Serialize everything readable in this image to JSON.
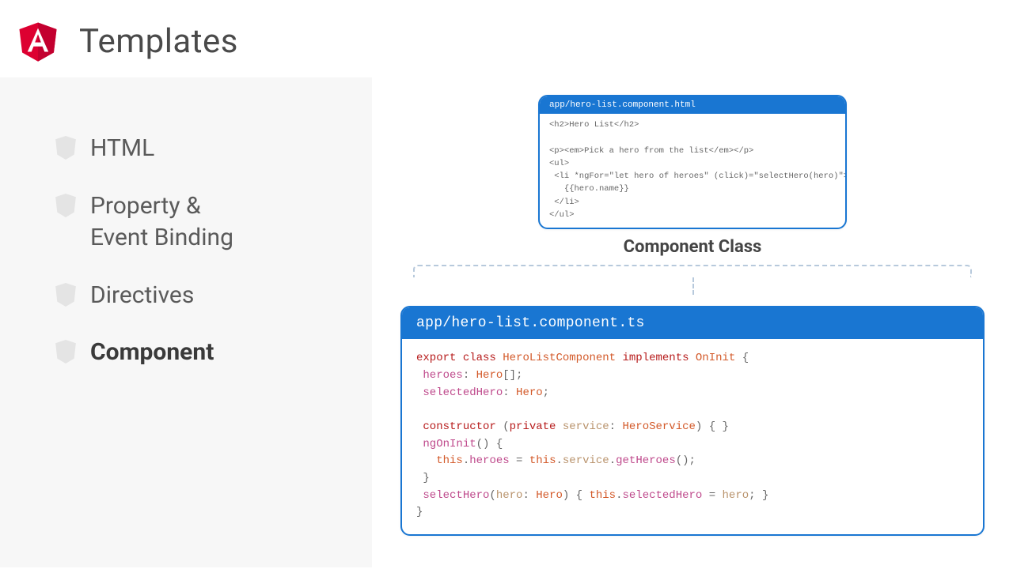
{
  "header": {
    "title": "Templates"
  },
  "colors": {
    "accent": "#1976d2",
    "logo": "#dd0031"
  },
  "nav": [
    {
      "label": "HTML",
      "active": false
    },
    {
      "label": "Property &\nEvent Binding",
      "active": false
    },
    {
      "label": "Directives",
      "active": false
    },
    {
      "label": "Component",
      "active": true
    }
  ],
  "section_label": "Component Class",
  "template_card": {
    "path": "app/hero-list.component.html",
    "lines": [
      "<h2>Hero List</h2>",
      "",
      "<p><em>Pick a hero from the list</em></p>",
      "<ul>",
      " <li *ngFor=\"let hero of heroes\" (click)=\"selectHero(hero)\">",
      "   {{hero.name}}",
      " </li>",
      "</ul>"
    ]
  },
  "component_card": {
    "path": "app/hero-list.component.ts",
    "lines": [
      "export class HeroListComponent implements OnInit {",
      " heroes: Hero[];",
      " selectedHero: Hero;",
      "",
      " constructor (private service: HeroService) { }",
      " ngOnInit() {",
      "   this.heroes = this.service.getHeroes();",
      " }",
      " selectHero(hero: Hero) { this.selectedHero = hero; }",
      "}"
    ]
  }
}
